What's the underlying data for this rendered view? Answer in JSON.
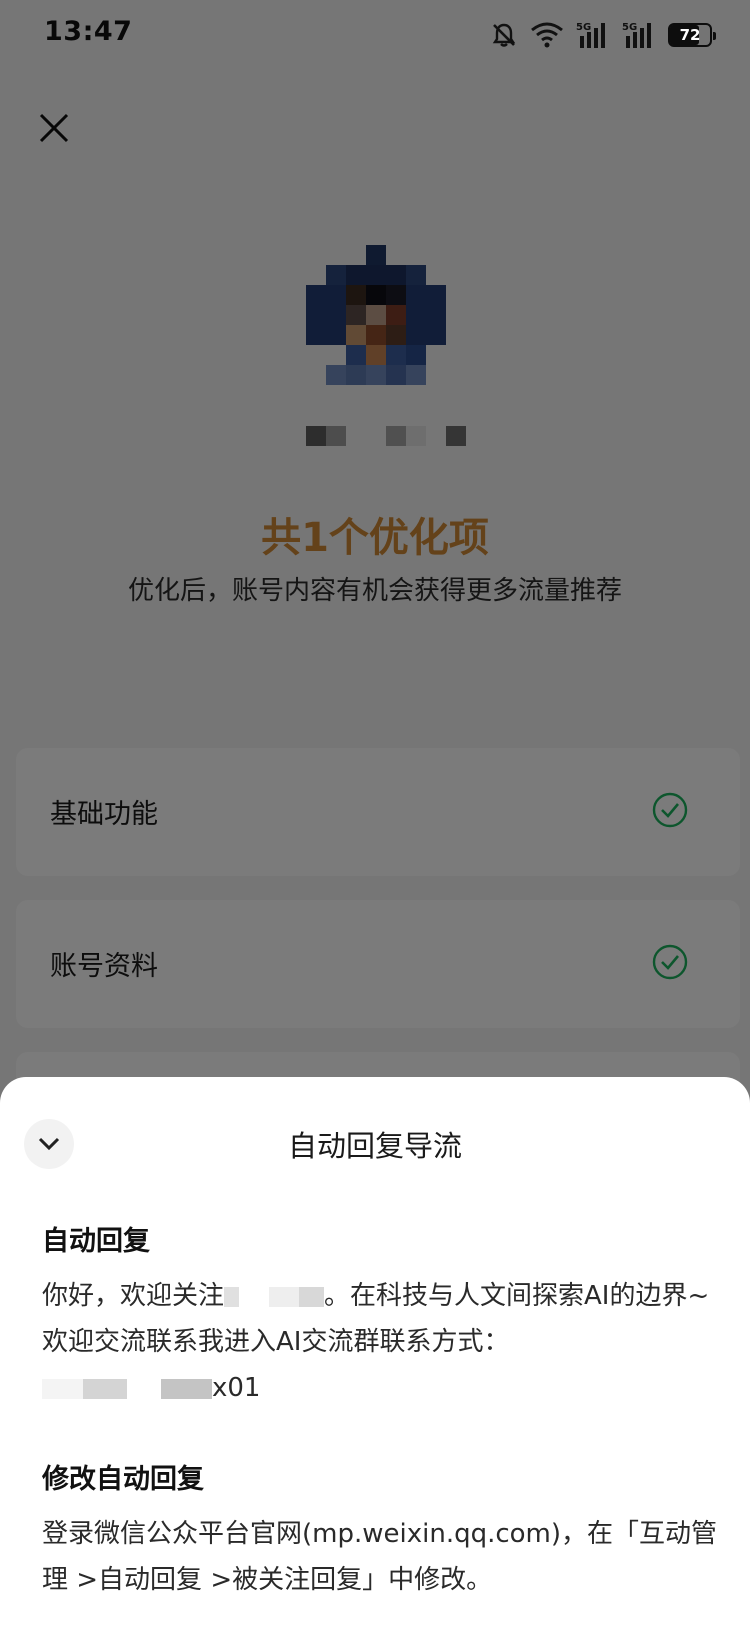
{
  "status_bar": {
    "time": "13:47",
    "network_1": "5G",
    "network_2": "5G",
    "battery": "72"
  },
  "icons": {
    "close": "close-icon",
    "mute": "bell-muted-icon",
    "wifi": "wifi-icon",
    "signal": "signal-icon",
    "check": "check-circle-icon",
    "collapse": "chevron-down-icon"
  },
  "summary": {
    "title": "共1个优化项",
    "description": "优化后，账号内容有机会获得更多流量推荐"
  },
  "check_items": [
    {
      "label": "基础功能",
      "status": "passed"
    },
    {
      "label": "账号资料",
      "status": "passed"
    }
  ],
  "sheet": {
    "title": "自动回复导流",
    "auto_reply_heading": "自动回复",
    "auto_reply_prefix": "你好，欢迎关注",
    "auto_reply_middle": "。在科技与人文间探索AI的边界~欢迎交流联系我进入AI交流群联系方式：",
    "auto_reply_suffix": "x01",
    "modify_heading": "修改自动回复",
    "modify_body": "登录微信公众平台官网(mp.weixin.qq.com)，在「互动管理 >自动回复 >被关注回复」中修改。"
  },
  "colors": {
    "accent_orange": "#c98534",
    "success_green": "#1aad5a"
  }
}
